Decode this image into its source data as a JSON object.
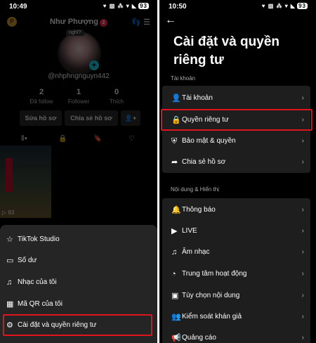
{
  "left": {
    "status": {
      "time": "10:49",
      "icons": "♥ ▥ ⁂ ▾ ◣",
      "battery": "93"
    },
    "profile": {
      "avatar_initial": "P",
      "name": "Như Phượng",
      "badge": "2",
      "bubble": "nghĩ?",
      "handle": "@nhphngnguyn442",
      "stats": [
        {
          "num": "2",
          "label": "Đã follow"
        },
        {
          "num": "1",
          "label": "Follower"
        },
        {
          "num": "0",
          "label": "Thích"
        }
      ],
      "edit_btn": "Sửa hồ sơ",
      "share_btn": "Chia sẻ hồ sơ",
      "views": "▷ 93"
    },
    "sheet": [
      {
        "icon": "☆",
        "label": "TikTok Studio"
      },
      {
        "icon": "▭",
        "label": "Số dư"
      },
      {
        "icon": "♫",
        "label": "Nhạc của tôi"
      },
      {
        "icon": "▦",
        "label": "Mã QR của tôi"
      },
      {
        "icon": "⚙",
        "label": "Cài đặt và quyền riêng tư"
      }
    ]
  },
  "right": {
    "status": {
      "time": "10:50",
      "icons": "♥ ▥ ⁂ ▾ ◣",
      "battery": "93"
    },
    "title": "Cài đặt và quyền riêng tư",
    "section_account": "Tài khoản",
    "account_items": [
      {
        "icon": "👤",
        "label": "Tài khoản"
      },
      {
        "icon": "🔒",
        "label": "Quyền riêng tư"
      },
      {
        "icon": "⛨",
        "label": "Bảo mật & quyền"
      },
      {
        "icon": "➦",
        "label": "Chia sẻ hồ sơ"
      }
    ],
    "section_content": "Nội dung & Hiển thị",
    "content_items": [
      {
        "icon": "🔔",
        "label": "Thông báo"
      },
      {
        "icon": "▶",
        "label": "LIVE"
      },
      {
        "icon": "♫",
        "label": "Âm nhạc"
      },
      {
        "icon": "◔",
        "label": "Trung tâm hoạt động"
      },
      {
        "icon": "▣",
        "label": "Tùy chọn nội dung"
      },
      {
        "icon": "👥",
        "label": "Kiểm soát khán giả"
      },
      {
        "icon": "📢",
        "label": "Quảng cáo"
      }
    ]
  }
}
